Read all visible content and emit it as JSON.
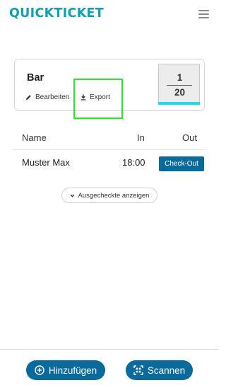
{
  "header": {
    "brand": "QUICKTICKET",
    "menu_icon": "hamburger-menu-icon"
  },
  "event_card": {
    "title": "Bar",
    "edit_label": "Bearbeiten",
    "edit_icon": "pencil-icon",
    "export_label": "Export",
    "export_icon": "download-icon",
    "counter": {
      "checked_in": "1",
      "capacity": "20",
      "progress_fraction": 1.0
    }
  },
  "table": {
    "columns": {
      "name": "Name",
      "in": "In",
      "out": "Out"
    },
    "rows": [
      {
        "name": "Muster Max",
        "in": "18:00",
        "action": "Check-Out"
      }
    ]
  },
  "show_checked_out": {
    "label": "Ausgecheckte anzeigen",
    "icon": "chevron-down-icon"
  },
  "footer": {
    "add_label": "Hinzufügen",
    "add_icon": "plus-circle-icon",
    "scan_label": "Scannen",
    "scan_icon": "qr-scan-icon"
  },
  "colors": {
    "brand": "#0f9fb3",
    "primary": "#0a6a9c",
    "progress": "#21d8e8",
    "highlight": "#2de52d"
  }
}
